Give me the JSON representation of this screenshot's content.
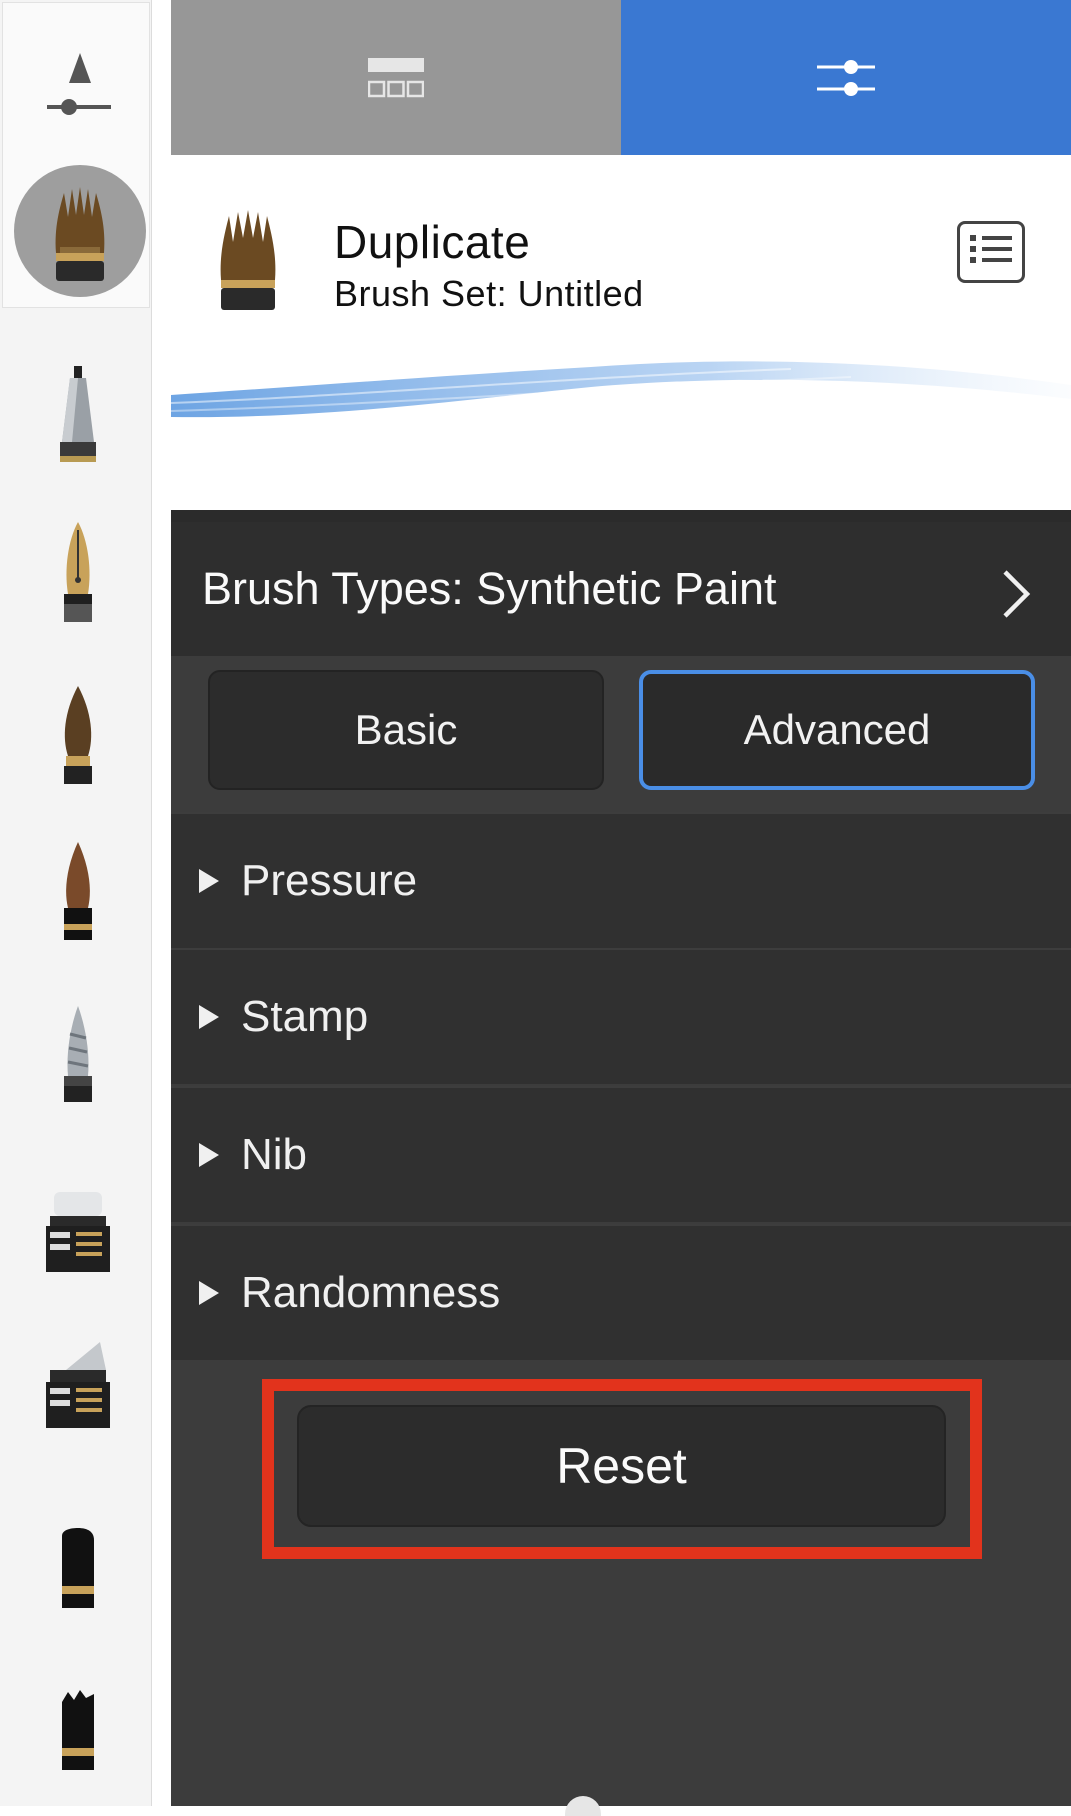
{
  "tabs": {
    "library_icon": "brush-library-icon",
    "settings_icon": "sliders-icon"
  },
  "brush": {
    "name": "Duplicate",
    "set": "Brush Set: Untitled"
  },
  "brush_types": {
    "label": "Brush Types: Synthetic Paint"
  },
  "mode": {
    "basic": "Basic",
    "advanced": "Advanced",
    "selected": "Advanced"
  },
  "sections": [
    {
      "label": "Pressure"
    },
    {
      "label": "Stamp"
    },
    {
      "label": "Nib"
    },
    {
      "label": "Randomness"
    }
  ],
  "reset_label": "Reset",
  "colors": {
    "accent": "#3a78d2",
    "highlight": "#e2331c",
    "panel_dark": "#303030"
  }
}
